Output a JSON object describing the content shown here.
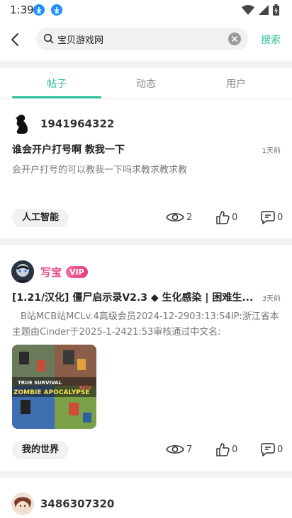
{
  "status_bar": {
    "time": "1:39"
  },
  "search": {
    "query": "宝贝游戏网",
    "submit_label": "搜索"
  },
  "tabs": [
    {
      "label": "帖子",
      "active": true
    },
    {
      "label": "动态",
      "active": false
    },
    {
      "label": "用户",
      "active": false
    }
  ],
  "posts": [
    {
      "author": "1941964322",
      "title": "谁会开户打号啊 教我一下",
      "time": "1天前",
      "content": "会开户打号的可以教我一下吗求教求教求教",
      "tag": "人工智能",
      "views": "2",
      "likes": "0",
      "comments": "0"
    },
    {
      "author": "写宝",
      "vip_label": "VIP",
      "title": "[1.21/汉化] 僵尸启示录V2.3 ◆ 生化感染 | 困难生...",
      "time": "3天前",
      "content": "B站MCB站MCLv.4高级会员2024-12-2903:13:54IP:浙江省本主题由Cinder于2025-1-2421:53审核通过中文名:",
      "thumb_caption": [
        "TRUE SURVIVAL",
        "ZOMBIE APOCALYPSE",
        "BETA"
      ],
      "tag": "我的世界",
      "views": "7",
      "likes": "0",
      "comments": "0"
    },
    {
      "author": "3486307320"
    }
  ],
  "colors": {
    "accent": "#2dbd98",
    "vip": "#e34c82"
  }
}
